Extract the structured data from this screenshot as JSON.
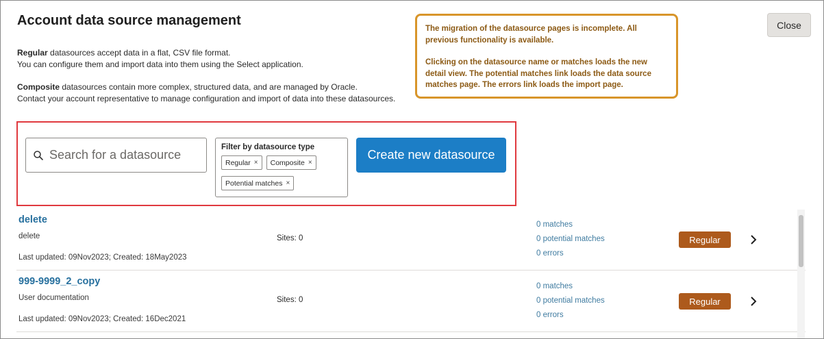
{
  "header": {
    "title": "Account data source management",
    "close_label": "Close"
  },
  "description": {
    "regular_bold": "Regular",
    "regular_line1": " datasources accept data in a flat, CSV file format.",
    "regular_line2": "You can configure them and import data into them using the Select application.",
    "composite_bold": "Composite",
    "composite_line1": " datasources contain more complex, structured data, and are managed by Oracle.",
    "composite_line2": "Contact your account representative to manage configuration and import of data into these datasources."
  },
  "notice": {
    "paragraph1": "The migration of the datasource pages is incomplete. All previous functionality is available.",
    "paragraph2": "Clicking on the datasource name or matches loads the new detail view. The potential matches link loads the data source matches page. The errors link loads the import page.",
    "text_color": "#8c5a14",
    "border_color": "#d8952a"
  },
  "search": {
    "placeholder": "Search for a datasource",
    "value": "",
    "icon": "search-icon"
  },
  "filter": {
    "title": "Filter by datasource type",
    "chips": [
      {
        "label": "Regular",
        "remove": "×"
      },
      {
        "label": "Composite",
        "remove": "×"
      },
      {
        "label": "Potential matches",
        "remove": "×"
      }
    ]
  },
  "create_button": {
    "label": "Create new datasource",
    "color": "#1c7ec6"
  },
  "datasources": [
    {
      "name": "delete",
      "description": "delete",
      "meta": "Last updated: 09Nov2023; Created: 18May2023",
      "sites": "Sites: 0",
      "matches": "0 matches",
      "potential_matches": "0 potential matches",
      "errors": "0 errors",
      "type": "Regular"
    },
    {
      "name": "999-9999_2_copy",
      "description": "User documentation",
      "meta": "Last updated: 09Nov2023; Created: 16Dec2021",
      "sites": "Sites: 0",
      "matches": "0 matches",
      "potential_matches": "0 potential matches",
      "errors": "0 errors",
      "type": "Regular"
    }
  ],
  "colors": {
    "badge": "#ad5a1c",
    "link": "#27709e",
    "highlight_border": "#e0393e"
  }
}
